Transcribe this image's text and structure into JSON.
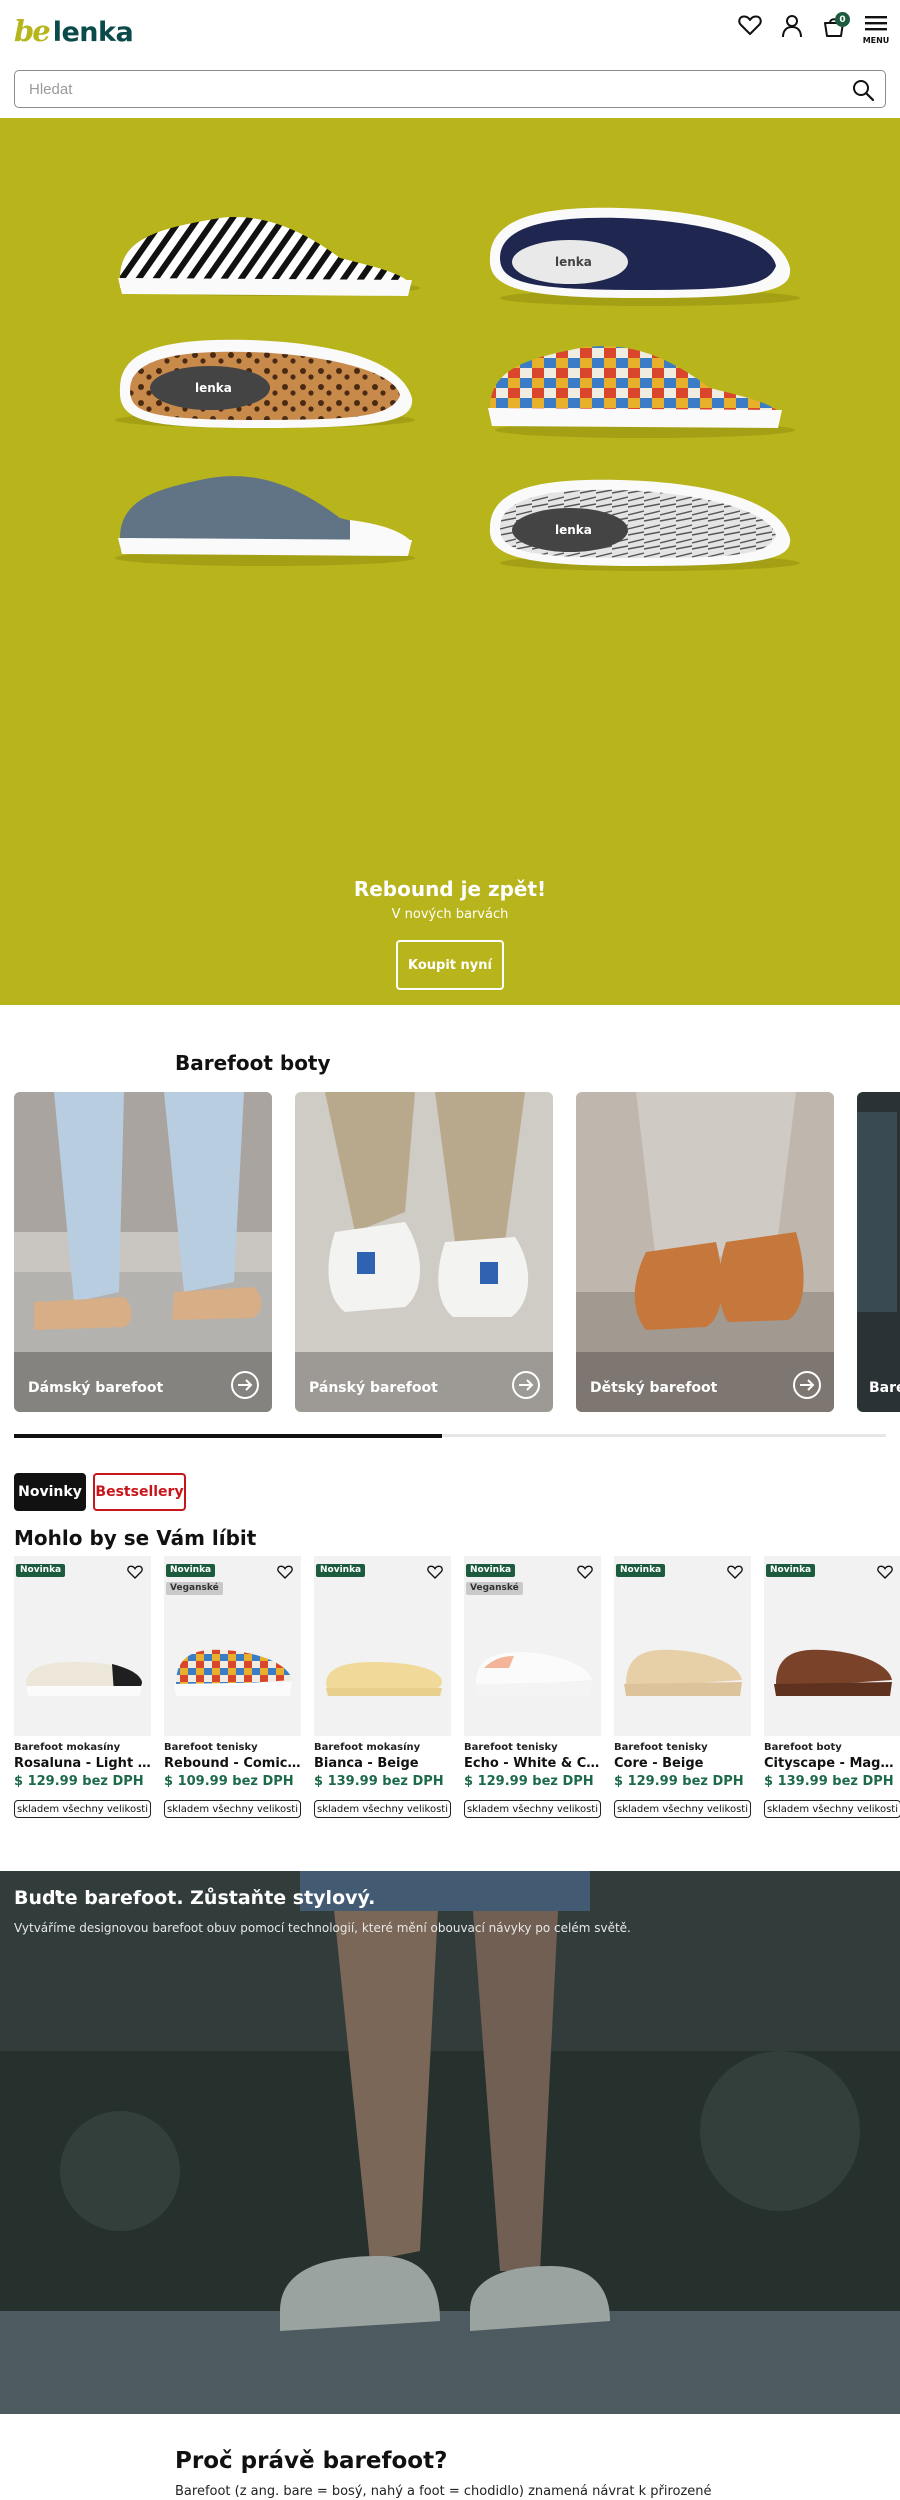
{
  "header": {
    "logo_be": "be",
    "logo_text": "lenka",
    "cart_count": "0",
    "menu_label": "MENU",
    "icons": [
      "heart-icon",
      "user-icon",
      "cart-icon",
      "menu-icon"
    ]
  },
  "search": {
    "placeholder": "Hledat"
  },
  "hero": {
    "title": "Rebound je zpět!",
    "subtitle": "V nových barvách",
    "button": "Koupit nyní",
    "background": "#b8b41b"
  },
  "categories": {
    "title": "Barefoot boty",
    "items": [
      {
        "label": "Dámský barefoot"
      },
      {
        "label": "Pánský barefoot"
      },
      {
        "label": "Dětský barefoot"
      },
      {
        "label": "Bare"
      }
    ]
  },
  "tabs": {
    "new": "Novinky",
    "bestsellers": "Bestsellery"
  },
  "products": {
    "title": "Mohlo by se Vám líbit",
    "items": [
      {
        "badge": "Novinka",
        "vegan": "",
        "category": "Barefoot mokasíny",
        "name": "Rosaluna - Light B…",
        "price": "$ 129.99 bez DPH",
        "stock": "skladem všechny velikosti"
      },
      {
        "badge": "Novinka",
        "vegan": "Veganské",
        "category": "Barefoot tenisky",
        "name": "Rebound - Comic…",
        "price": "$ 109.99 bez DPH",
        "stock": "skladem všechny velikosti"
      },
      {
        "badge": "Novinka",
        "vegan": "",
        "category": "Barefoot mokasíny",
        "name": "Bianca - Beige",
        "price": "$ 139.99 bez DPH",
        "stock": "skladem všechny velikosti"
      },
      {
        "badge": "Novinka",
        "vegan": "Veganské",
        "category": "Barefoot tenisky",
        "name": "Echo - White & Co…",
        "price": "$ 129.99 bez DPH",
        "stock": "skladem všechny velikosti"
      },
      {
        "badge": "Novinka",
        "vegan": "",
        "category": "Barefoot tenisky",
        "name": "Core - Beige",
        "price": "$ 129.99 bez DPH",
        "stock": "skladem všechny velikosti"
      },
      {
        "badge": "Novinka",
        "vegan": "",
        "category": "Barefoot boty",
        "name": "Cityscape - Magn…",
        "price": "$ 139.99 bez DPH",
        "stock": "skladem všechny velikosti"
      }
    ]
  },
  "banner": {
    "title": "Buďte barefoot. Zůstaňte stylový.",
    "subtitle": "Vytváříme designovou barefoot obuv pomocí technologií, které mění obouvací návyky po celém světě."
  },
  "why": {
    "title": "Proč právě barefoot?",
    "text": "Barefoot (z ang. bare = bosý, nahý a foot = chodidlo) znamená návrat k přirozené"
  },
  "colors": {
    "brand_olive": "#b6b51c",
    "brand_teal": "#0b4a4a",
    "price_green": "#1d6a4a",
    "badge_green": "#1d5b3f",
    "bestseller_red": "#c8151b"
  }
}
